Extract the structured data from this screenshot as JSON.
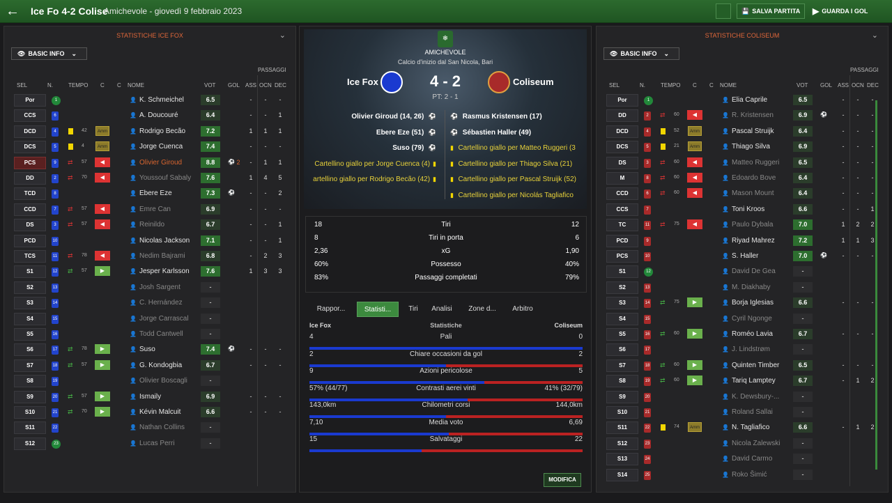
{
  "header": {
    "title": "Ice Fo 4-2 Colise",
    "subtitle": "Amichevole - giovedì 9 febbraio 2023",
    "save_label": "SALVA PARTITA",
    "goals_label": "GUARDA I GOL"
  },
  "left": {
    "title": "STATISTICHE ICE FOX",
    "view": "BASIC INFO"
  },
  "right": {
    "title": "STATISTICHE COLISEUM",
    "view": "BASIC INFO"
  },
  "cols": {
    "sel": "SEL",
    "n": "N.",
    "tempo": "TEMPO",
    "c": "C",
    "nome": "NOME",
    "vot": "VOT",
    "gol": "GOL",
    "ass": "ASS",
    "passaggi": "PASSAGGI",
    "ocn": "OCN",
    "dec": "DEC"
  },
  "left_players": [
    {
      "pos": "Por",
      "n": "1",
      "name": "K. Schmeichel",
      "vot": "6.5",
      "ass": "-",
      "ocn": "-",
      "dec": "-",
      "gk": true
    },
    {
      "pos": "CCS",
      "n": "6",
      "name": "A. Doucouré",
      "vot": "6.4",
      "ass": "-",
      "ocn": "-",
      "dec": "1"
    },
    {
      "pos": "DCD",
      "n": "4",
      "name": "Rodrigo Becão",
      "vot": "7.2",
      "ass": "1",
      "ocn": "1",
      "dec": "1",
      "card": "y",
      "tm": "42",
      "amm": "Amm"
    },
    {
      "pos": "DCS",
      "n": "5",
      "name": "Jorge Cuenca",
      "vot": "7.4",
      "ass": "-",
      "ocn": "-",
      "dec": "-",
      "card": "y",
      "tm": "4",
      "amm": "Amm"
    },
    {
      "pos": "PCS",
      "n": "9",
      "name": "Olivier Giroud",
      "vot": "8.8",
      "gol": "2",
      "ass": "-",
      "ocn": "1",
      "dec": "1",
      "red": true,
      "sub": "out",
      "tm": "57",
      "og": true
    },
    {
      "pos": "DD",
      "n": "2",
      "name": "Youssouf Sabaly",
      "vot": "7.6",
      "ass": "1",
      "ocn": "4",
      "dec": "5",
      "sub": "out",
      "tm": "70",
      "dim": true
    },
    {
      "pos": "TCD",
      "n": "8",
      "name": "Ebere Eze",
      "vot": "7.3",
      "gol": "1",
      "ass": "-",
      "ocn": "-",
      "dec": "2"
    },
    {
      "pos": "CCD",
      "n": "7",
      "name": "Emre Can",
      "vot": "6.9",
      "ass": "-",
      "ocn": "-",
      "dec": "-",
      "sub": "out",
      "tm": "57",
      "dim": true
    },
    {
      "pos": "DS",
      "n": "3",
      "name": "Reinildo",
      "vot": "6.7",
      "ass": "-",
      "ocn": "-",
      "dec": "1",
      "sub": "out",
      "tm": "57",
      "dim": true
    },
    {
      "pos": "PCD",
      "n": "10",
      "name": "Nicolas Jackson",
      "vot": "7.1",
      "ass": "-",
      "ocn": "-",
      "dec": "1"
    },
    {
      "pos": "TCS",
      "n": "11",
      "name": "Nedim Bajrami",
      "vot": "6.8",
      "ass": "-",
      "ocn": "2",
      "dec": "3",
      "sub": "out",
      "tm": "78",
      "dim": true
    },
    {
      "pos": "S1",
      "n": "12",
      "name": "Jesper Karlsson",
      "vot": "7.6",
      "ass": "1",
      "ocn": "3",
      "dec": "3",
      "sub": "in",
      "tm": "57"
    },
    {
      "pos": "S2",
      "n": "13",
      "name": "Josh Sargent",
      "vot": "-",
      "ass": "",
      "ocn": "",
      "dec": "",
      "dim": true
    },
    {
      "pos": "S3",
      "n": "14",
      "name": "C. Hernández",
      "vot": "-",
      "dim": true
    },
    {
      "pos": "S4",
      "n": "15",
      "name": "Jorge Carrascal",
      "vot": "-",
      "dim": true
    },
    {
      "pos": "S5",
      "n": "16",
      "name": "Todd Cantwell",
      "vot": "-",
      "dim": true
    },
    {
      "pos": "S6",
      "n": "17",
      "name": "Suso",
      "vot": "7.4",
      "gol": "1",
      "ass": "-",
      "ocn": "-",
      "dec": "-",
      "sub": "in",
      "tm": "78"
    },
    {
      "pos": "S7",
      "n": "18",
      "name": "G. Kondogbia",
      "vot": "6.7",
      "ass": "-",
      "ocn": "-",
      "dec": "-",
      "sub": "in",
      "tm": "57"
    },
    {
      "pos": "S8",
      "n": "19",
      "name": "Olivier Boscagli",
      "vot": "-",
      "dim": true
    },
    {
      "pos": "S9",
      "n": "20",
      "name": "Ismaily",
      "vot": "6.9",
      "ass": "-",
      "ocn": "-",
      "dec": "-",
      "sub": "in",
      "tm": "57"
    },
    {
      "pos": "S10",
      "n": "21",
      "name": "Kévin Malcuit",
      "vot": "6.6",
      "ass": "-",
      "ocn": "-",
      "dec": "-",
      "sub": "in",
      "tm": "70"
    },
    {
      "pos": "S11",
      "n": "22",
      "name": "Nathan Collins",
      "vot": "-",
      "dim": true
    },
    {
      "pos": "S12",
      "n": "23",
      "name": "Lucas Perri",
      "vot": "-",
      "dim": true,
      "gk": true
    }
  ],
  "right_players": [
    {
      "pos": "Por",
      "n": "1",
      "name": "Elia Caprile",
      "vot": "6.5",
      "ass": "-",
      "ocn": "-",
      "dec": "-",
      "gk": true
    },
    {
      "pos": "DD",
      "n": "2",
      "name": "R. Kristensen",
      "vot": "6.9",
      "gol": "1",
      "ass": "-",
      "ocn": "-",
      "dec": "-",
      "sub": "out",
      "tm": "60",
      "dim": true
    },
    {
      "pos": "DCD",
      "n": "4",
      "name": "Pascal Struijk",
      "vot": "6.4",
      "ass": "-",
      "ocn": "-",
      "dec": "-",
      "card": "y",
      "tm": "52",
      "amm": "Amm"
    },
    {
      "pos": "DCS",
      "n": "5",
      "name": "Thiago Silva",
      "vot": "6.9",
      "ass": "-",
      "ocn": "-",
      "dec": "-",
      "card": "y",
      "tm": "21",
      "amm": "Amm"
    },
    {
      "pos": "DS",
      "n": "3",
      "name": "Matteo Ruggeri",
      "vot": "6.5",
      "ass": "-",
      "ocn": "-",
      "dec": "-",
      "sub": "out",
      "tm": "60",
      "dim": true
    },
    {
      "pos": "M",
      "n": "8",
      "name": "Edoardo Bove",
      "vot": "6.4",
      "ass": "-",
      "ocn": "-",
      "dec": "-",
      "sub": "out",
      "tm": "60",
      "dim": true
    },
    {
      "pos": "CCD",
      "n": "6",
      "name": "Mason Mount",
      "vot": "6.4",
      "ass": "-",
      "ocn": "-",
      "dec": "-",
      "sub": "out",
      "tm": "60",
      "dim": true
    },
    {
      "pos": "CCS",
      "n": "7",
      "name": "Toni Kroos",
      "vot": "6.6",
      "ass": "-",
      "ocn": "-",
      "dec": "1"
    },
    {
      "pos": "TC",
      "n": "11",
      "name": "Paulo Dybala",
      "vot": "7.0",
      "ass": "1",
      "ocn": "2",
      "dec": "2",
      "sub": "out",
      "tm": "75",
      "dim": true
    },
    {
      "pos": "PCD",
      "n": "9",
      "name": "Riyad Mahrez",
      "vot": "7.2",
      "ass": "1",
      "ocn": "1",
      "dec": "3"
    },
    {
      "pos": "PCS",
      "n": "10",
      "name": "S. Haller",
      "vot": "7.0",
      "gol": "1",
      "ass": "-",
      "ocn": "-",
      "dec": "-"
    },
    {
      "pos": "S1",
      "n": "12",
      "name": "David De Gea",
      "vot": "-",
      "dim": true,
      "gk": true
    },
    {
      "pos": "S2",
      "n": "13",
      "name": "M. Diakhaby",
      "vot": "-",
      "dim": true
    },
    {
      "pos": "S3",
      "n": "14",
      "name": "Borja Iglesias",
      "vot": "6.6",
      "ass": "-",
      "ocn": "-",
      "dec": "-",
      "sub": "in",
      "tm": "75"
    },
    {
      "pos": "S4",
      "n": "15",
      "name": "Cyril Ngonge",
      "vot": "-",
      "dim": true
    },
    {
      "pos": "S5",
      "n": "16",
      "name": "Roméo Lavia",
      "vot": "6.7",
      "ass": "-",
      "ocn": "-",
      "dec": "-",
      "sub": "in",
      "tm": "60"
    },
    {
      "pos": "S6",
      "n": "17",
      "name": "J. Lindstrøm",
      "vot": "-",
      "dim": true
    },
    {
      "pos": "S7",
      "n": "18",
      "name": "Quinten Timber",
      "vot": "6.5",
      "ass": "-",
      "ocn": "-",
      "dec": "-",
      "sub": "in",
      "tm": "60"
    },
    {
      "pos": "S8",
      "n": "19",
      "name": "Tariq Lamptey",
      "vot": "6.7",
      "ass": "-",
      "ocn": "1",
      "dec": "2",
      "sub": "in",
      "tm": "60"
    },
    {
      "pos": "S9",
      "n": "20",
      "name": "K. Dewsbury-...",
      "vot": "-",
      "dim": true
    },
    {
      "pos": "S10",
      "n": "21",
      "name": "Roland Sallai",
      "vot": "-",
      "dim": true
    },
    {
      "pos": "S11",
      "n": "22",
      "name": "N. Tagliafico",
      "vot": "6.6",
      "ass": "-",
      "ocn": "1",
      "dec": "2",
      "card": "y",
      "tm": "74",
      "amm": "Amm"
    },
    {
      "pos": "S12",
      "n": "23",
      "name": "Nicola Zalewski",
      "vot": "-",
      "dim": true
    },
    {
      "pos": "S13",
      "n": "24",
      "name": "David Carmo",
      "vot": "-",
      "dim": true
    },
    {
      "pos": "S14",
      "n": "25",
      "name": "Roko Šimić",
      "vot": "-",
      "dim": true
    }
  ],
  "match": {
    "comp": "AMICHEVOLE",
    "venue": "Calcio d'inizio dal San Nicola, Bari",
    "home": "Ice Fox",
    "away": "Coliseum",
    "score": "4 - 2",
    "ht": "PT: 2 - 1"
  },
  "home_events": [
    "Olivier Giroud (14, 26)",
    "Ebere Eze (51)",
    "Suso (79)",
    "Cartellino giallo per Jorge Cuenca (4)",
    "artellino giallo per Rodrigo Becão (42)"
  ],
  "away_events": [
    "Rasmus Kristensen (17)",
    "Sébastien Haller (49)",
    "Cartellino giallo per Matteo Ruggeri (3",
    "Cartellino giallo per Thiago Silva (21)",
    "Cartellino giallo per Pascal Struijk (52)",
    "Cartellino giallo per Nicolás Tagliafico"
  ],
  "summary": [
    {
      "l": "18",
      "label": "Tiri",
      "r": "12"
    },
    {
      "l": "8",
      "label": "Tiri in porta",
      "r": "6"
    },
    {
      "l": "2,36",
      "label": "xG",
      "r": "1,90"
    },
    {
      "l": "60%",
      "label": "Possesso",
      "r": "40%"
    },
    {
      "l": "83%",
      "label": "Passaggi completati",
      "r": "79%"
    }
  ],
  "tabs": [
    "Rappor...",
    "Statisti...",
    "Tiri",
    "Analisi",
    "Zone d...",
    "Arbitro"
  ],
  "detail": {
    "home": "Ice Fox",
    "mid": "Statistiche",
    "away": "Coliseum"
  },
  "detail_rows": [
    {
      "l": "4",
      "label": "Pali",
      "r": "0",
      "share": 1.0
    },
    {
      "l": "2",
      "label": "Chiare occasioni da gol",
      "r": "2",
      "share": 0.5
    },
    {
      "l": "9",
      "label": "Azioni pericolose",
      "r": "5",
      "share": 0.64
    },
    {
      "l": "57% (44/77)",
      "label": "Contrasti aerei vinti",
      "r": "41% (32/79)",
      "share": 0.58
    },
    {
      "l": "143,0km",
      "label": "Chilometri corsi",
      "r": "144,0km",
      "share": 0.5
    },
    {
      "l": "7,10",
      "label": "Media voto",
      "r": "6,69",
      "share": 0.51
    },
    {
      "l": "15",
      "label": "Salvataggi",
      "r": "22",
      "share": 0.41
    }
  ],
  "modify_label": "MODIFICA"
}
